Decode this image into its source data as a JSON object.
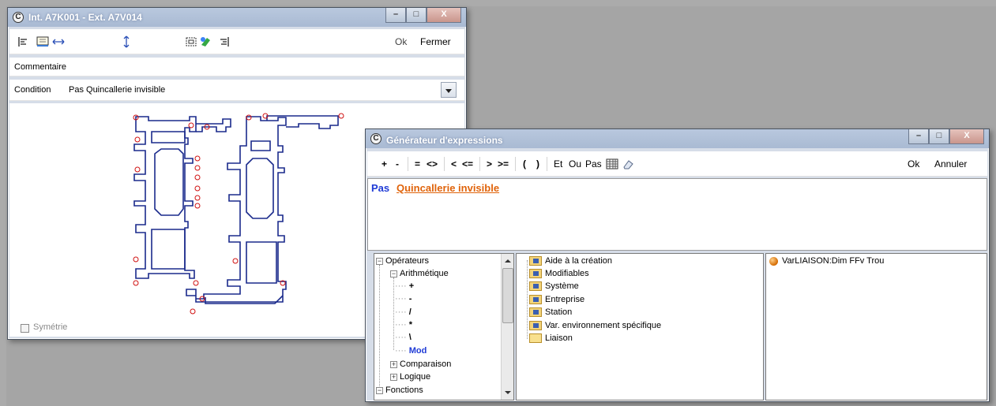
{
  "colors": {
    "title_text": "#ffffff",
    "link_orange": "#e0630a",
    "keyword_blue": "#1f3bd6",
    "drawing_stroke": "#1a2a8c",
    "point_red": "#d01010"
  },
  "window1": {
    "title": "Int. A7K001 - Ext. A7V014",
    "app_icon": "C",
    "controls": {
      "minimize": "–",
      "maximize": "□",
      "close": "X"
    },
    "toolbar": {
      "icons": [
        "align-left-icon",
        "measure-icon",
        "horizontal-arrow-icon",
        "vertical-arrow-icon",
        "frame-icon",
        "paint-icon",
        "align-right-icon"
      ],
      "ok_label": "Ok",
      "close_label": "Fermer"
    },
    "comment": {
      "label": "Commentaire",
      "value": ""
    },
    "condition": {
      "label": "Condition",
      "value": "Pas Quincallerie invisible"
    },
    "symmetry_label": "Symétrie"
  },
  "window2": {
    "title": "Générateur d'expressions",
    "app_icon": "C",
    "controls": {
      "minimize": "–",
      "maximize": "□",
      "close": "X"
    },
    "toolbar": {
      "plus": "+",
      "minus": "-",
      "equals": "=",
      "not_equal": "<>",
      "less": "<",
      "less_equal": "<=",
      "greater": ">",
      "greater_equal": ">=",
      "open_paren": "(",
      "close_paren": ")",
      "and": "Et",
      "or": "Ou",
      "not": "Pas",
      "icons": [
        "grid-icon",
        "eraser-icon"
      ],
      "ok_label": "Ok",
      "cancel_label": "Annuler"
    },
    "expression": {
      "keyword": "Pas",
      "link": "Quincallerie invisible"
    },
    "tree": [
      {
        "label": "Opérateurs",
        "toggle": "−"
      },
      {
        "label": "Arithmétique",
        "toggle": "−"
      },
      {
        "label": "+"
      },
      {
        "label": "-"
      },
      {
        "label": "/"
      },
      {
        "label": "*"
      },
      {
        "label": "\\"
      },
      {
        "label": "Mod"
      },
      {
        "label": "Comparaison",
        "toggle": "+"
      },
      {
        "label": "Logique",
        "toggle": "+"
      },
      {
        "label": "Fonctions",
        "toggle": "−"
      }
    ],
    "categories": [
      "Aide à la création",
      "Modifiables",
      "Système",
      "Entreprise",
      "Station",
      "Var. environnement spécifique",
      "Liaison"
    ],
    "variables": [
      "VarLIAISON:Dim FFv Trou"
    ]
  }
}
